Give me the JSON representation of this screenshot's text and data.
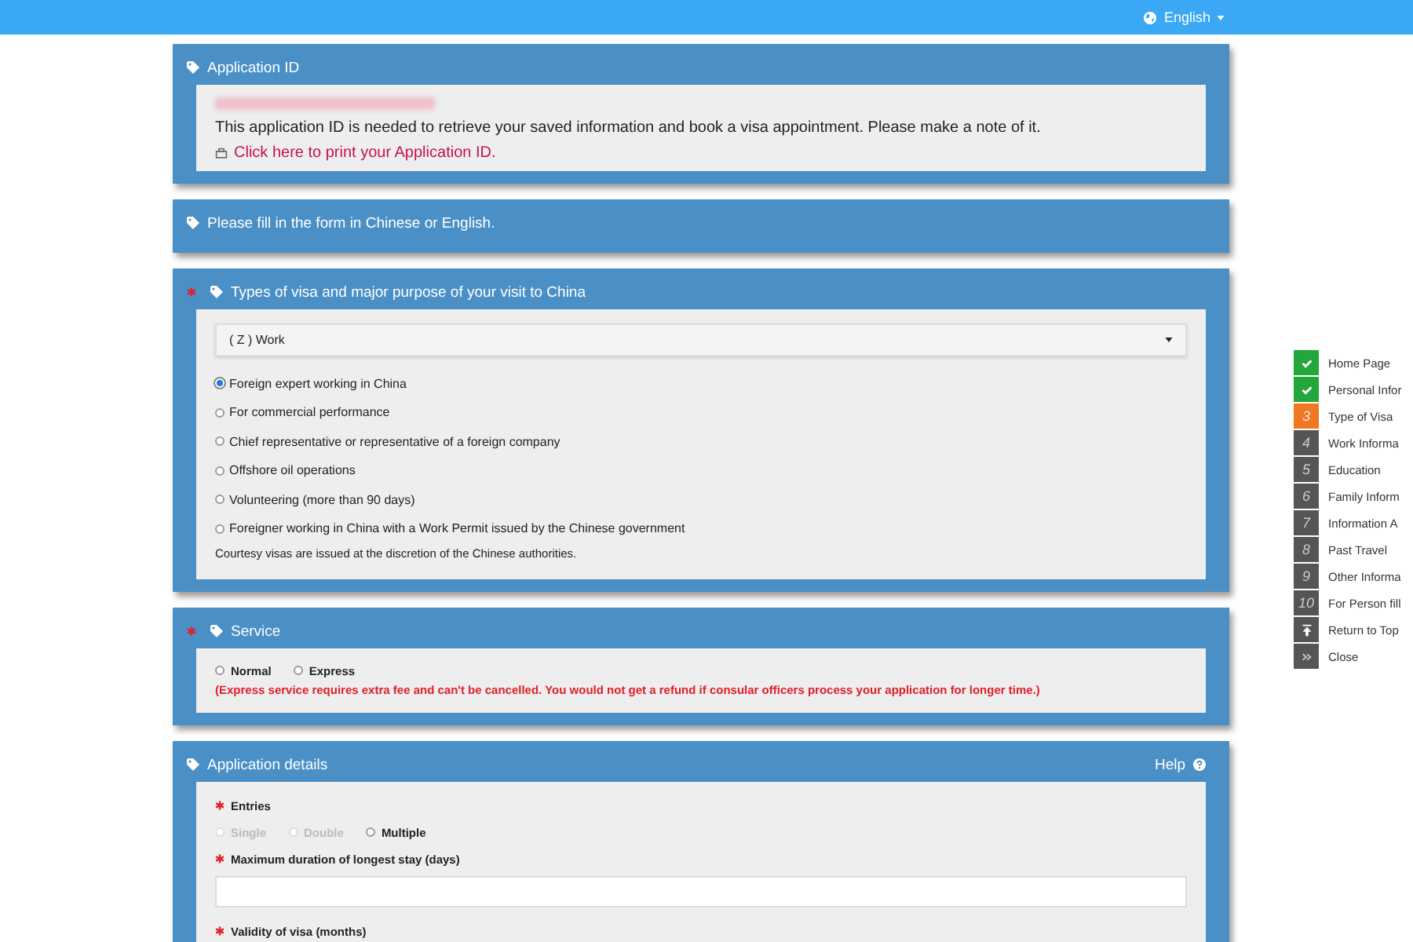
{
  "topbar": {
    "language": "English"
  },
  "application_id": {
    "title": "Application ID",
    "note": "This application ID is needed to retrieve your saved information and book a visa appointment. Please make a note of it.",
    "print_link": "Click here to print your Application ID."
  },
  "instruction": {
    "title": "Please fill in the form in Chinese or English."
  },
  "visa_type": {
    "title": "Types of visa and major purpose of your visit to China",
    "required": true,
    "dropdown": "( Z ) Work",
    "options": [
      {
        "label": "Foreign expert working in China",
        "selected": true
      },
      {
        "label": "For commercial performance",
        "selected": false
      },
      {
        "label": "Chief representative or representative of a foreign company",
        "selected": false
      },
      {
        "label": "Offshore oil operations",
        "selected": false
      },
      {
        "label": "Volunteering (more than 90 days)",
        "selected": false
      },
      {
        "label": "Foreigner working in China with a Work Permit issued by the Chinese government",
        "selected": false
      }
    ],
    "note": "Courtesy visas are issued at the discretion of the Chinese authorities."
  },
  "service": {
    "title": "Service",
    "required": true,
    "options": [
      {
        "label": "Normal",
        "selected": false
      },
      {
        "label": "Express",
        "selected": false
      }
    ],
    "warning": "(Express service requires extra fee and can't be cancelled. You would not get a refund if consular officers process your application for longer time.)"
  },
  "application_details": {
    "title": "Application details",
    "help": "Help",
    "entries": {
      "label": "Entries",
      "required": true,
      "options": [
        {
          "label": "Single",
          "selected": false,
          "disabled": true
        },
        {
          "label": "Double",
          "selected": false,
          "disabled": true
        },
        {
          "label": "Multiple",
          "selected": false,
          "disabled": false
        }
      ]
    },
    "longest_stay": {
      "label": "Maximum duration of longest stay (days)",
      "required": true
    },
    "validity": {
      "label": "Validity of visa (months)",
      "required": true
    }
  },
  "steps": [
    {
      "kind": "done",
      "label": "Home Page"
    },
    {
      "kind": "done",
      "label": "Personal Infor"
    },
    {
      "kind": "current",
      "number": "3",
      "label": "Type of Visa"
    },
    {
      "kind": "todo",
      "number": "4",
      "label": "Work Informa"
    },
    {
      "kind": "todo",
      "number": "5",
      "label": "Education"
    },
    {
      "kind": "todo",
      "number": "6",
      "label": "Family Inform"
    },
    {
      "kind": "todo",
      "number": "7",
      "label": "Information A"
    },
    {
      "kind": "todo",
      "number": "8",
      "label": "Past Travel"
    },
    {
      "kind": "todo",
      "number": "9",
      "label": "Other Informa"
    },
    {
      "kind": "todo",
      "number": "10",
      "label": "For Person fill"
    },
    {
      "kind": "top",
      "label": "Return to Top"
    },
    {
      "kind": "close",
      "label": "Close"
    }
  ]
}
